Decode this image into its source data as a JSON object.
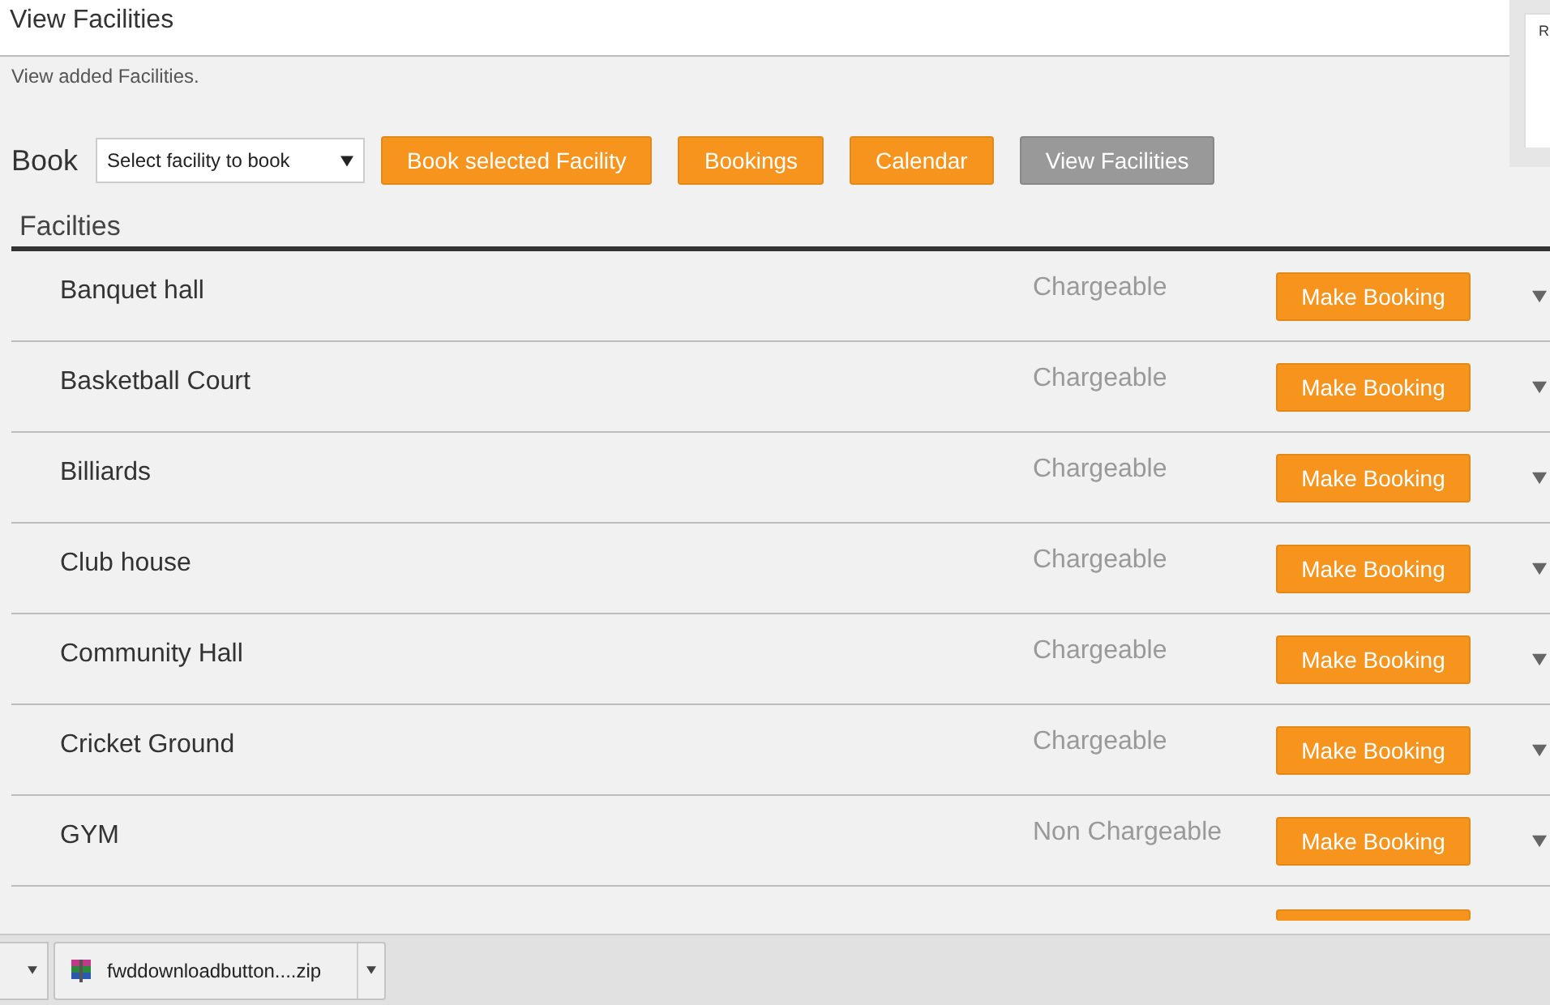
{
  "header": {
    "title": "View Facilities"
  },
  "subtitle": "View added Facilities.",
  "side_panel": {
    "title": "R"
  },
  "toolbar": {
    "label": "Book",
    "select": {
      "value": "Select facility to book"
    },
    "buttons": [
      {
        "label": "Book selected Facility",
        "selected": false
      },
      {
        "label": "Bookings",
        "selected": false
      },
      {
        "label": "Calendar",
        "selected": false
      },
      {
        "label": "View Facilities",
        "selected": true
      }
    ]
  },
  "section_title": "Facilties",
  "facilities": [
    {
      "name": "Banquet hall",
      "charge": "Chargeable",
      "action": "Make Booking"
    },
    {
      "name": "Basketball Court",
      "charge": "Chargeable",
      "action": "Make Booking"
    },
    {
      "name": "Billiards",
      "charge": "Chargeable",
      "action": "Make Booking"
    },
    {
      "name": "Club house",
      "charge": "Chargeable",
      "action": "Make Booking"
    },
    {
      "name": "Community Hall",
      "charge": "Chargeable",
      "action": "Make Booking"
    },
    {
      "name": "Cricket Ground",
      "charge": "Chargeable",
      "action": "Make Booking"
    },
    {
      "name": "GYM",
      "charge": "Non Chargeable",
      "action": "Make Booking"
    }
  ],
  "download_bar": {
    "items": [
      {
        "name": "fwddownloadbutton....zip"
      }
    ]
  }
}
